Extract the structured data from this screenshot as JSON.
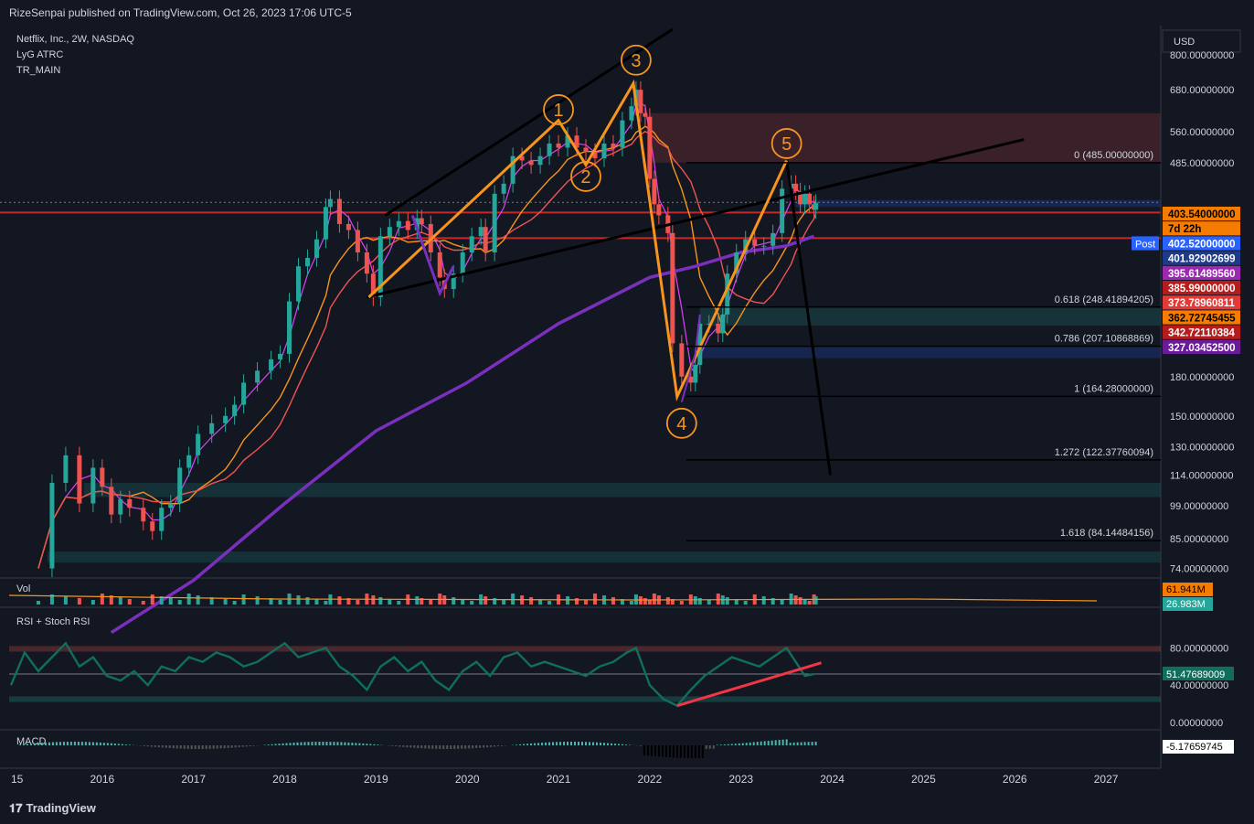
{
  "header": {
    "published": "RizeSenpai published on TradingView.com, Oct 26, 2023 17:06 UTC-5"
  },
  "legend": {
    "symbol": "Netflix, Inc., 2W, NASDAQ",
    "ind1": "LyG ATRC",
    "ind2": "TR_MAIN"
  },
  "currency": "USD",
  "footer": {
    "brand": "TradingView"
  },
  "colors": {
    "bg": "#131722",
    "up": "#26a69a",
    "down": "#ef5350",
    "orange": "#f7941d",
    "purple": "#7b2fbe",
    "pink": "#e040fb",
    "red": "#c62828",
    "black": "#000000",
    "text": "#d1d4dc"
  },
  "chart_data": {
    "type": "candlestick",
    "timeframe": "2W",
    "x_ticks": [
      "15",
      "2016",
      "2017",
      "2018",
      "2019",
      "2020",
      "2021",
      "2022",
      "2023",
      "2024",
      "2025",
      "2026",
      "2027"
    ],
    "y_scale": "log",
    "y_ticks": [
      "800.00000000",
      "680.00000000",
      "560.00000000",
      "485.00000000",
      "403.54000000",
      "180.00000000",
      "150.00000000",
      "130.00000000",
      "114.00000000",
      "99.00000000",
      "85.00000000",
      "74.00000000"
    ],
    "y_range": [
      72,
      900
    ],
    "close_series": [
      [
        2015.3,
        74
      ],
      [
        2015.45,
        110
      ],
      [
        2015.6,
        125
      ],
      [
        2015.75,
        100
      ],
      [
        2015.9,
        118
      ],
      [
        2016.0,
        108
      ],
      [
        2016.1,
        95
      ],
      [
        2016.2,
        102
      ],
      [
        2016.3,
        98
      ],
      [
        2016.45,
        92
      ],
      [
        2016.55,
        88
      ],
      [
        2016.65,
        98
      ],
      [
        2016.75,
        100
      ],
      [
        2016.85,
        118
      ],
      [
        2016.95,
        125
      ],
      [
        2017.05,
        138
      ],
      [
        2017.2,
        145
      ],
      [
        2017.35,
        150
      ],
      [
        2017.45,
        158
      ],
      [
        2017.55,
        175
      ],
      [
        2017.7,
        185
      ],
      [
        2017.85,
        195
      ],
      [
        2017.95,
        200
      ],
      [
        2018.05,
        255
      ],
      [
        2018.15,
        300
      ],
      [
        2018.25,
        312
      ],
      [
        2018.35,
        340
      ],
      [
        2018.45,
        395
      ],
      [
        2018.5,
        410
      ],
      [
        2018.6,
        365
      ],
      [
        2018.7,
        355
      ],
      [
        2018.8,
        320
      ],
      [
        2018.9,
        290
      ],
      [
        2018.97,
        260
      ],
      [
        2019.05,
        345
      ],
      [
        2019.15,
        360
      ],
      [
        2019.25,
        370
      ],
      [
        2019.35,
        355
      ],
      [
        2019.45,
        375
      ],
      [
        2019.5,
        365
      ],
      [
        2019.6,
        320
      ],
      [
        2019.7,
        285
      ],
      [
        2019.75,
        270
      ],
      [
        2019.85,
        290
      ],
      [
        2019.95,
        320
      ],
      [
        2020.05,
        345
      ],
      [
        2020.15,
        360
      ],
      [
        2020.2,
        320
      ],
      [
        2020.3,
        420
      ],
      [
        2020.4,
        440
      ],
      [
        2020.5,
        500
      ],
      [
        2020.6,
        490
      ],
      [
        2020.7,
        480
      ],
      [
        2020.8,
        500
      ],
      [
        2020.9,
        530
      ],
      [
        2021.0,
        520
      ],
      [
        2021.1,
        550
      ],
      [
        2021.2,
        520
      ],
      [
        2021.3,
        510
      ],
      [
        2021.4,
        495
      ],
      [
        2021.5,
        530
      ],
      [
        2021.6,
        520
      ],
      [
        2021.7,
        590
      ],
      [
        2021.8,
        630
      ],
      [
        2021.85,
        680
      ],
      [
        2021.9,
        610
      ],
      [
        2021.95,
        600
      ],
      [
        2022.0,
        450
      ],
      [
        2022.05,
        400
      ],
      [
        2022.1,
        380
      ],
      [
        2022.2,
        350
      ],
      [
        2022.25,
        210
      ],
      [
        2022.35,
        180
      ],
      [
        2022.45,
        175
      ],
      [
        2022.5,
        190
      ],
      [
        2022.55,
        230
      ],
      [
        2022.65,
        230
      ],
      [
        2022.75,
        220
      ],
      [
        2022.8,
        240
      ],
      [
        2022.85,
        290
      ],
      [
        2022.95,
        320
      ],
      [
        2023.05,
        340
      ],
      [
        2023.15,
        330
      ],
      [
        2023.25,
        330
      ],
      [
        2023.35,
        350
      ],
      [
        2023.45,
        430
      ],
      [
        2023.55,
        440
      ],
      [
        2023.6,
        425
      ],
      [
        2023.65,
        400
      ],
      [
        2023.7,
        420
      ],
      [
        2023.75,
        400
      ],
      [
        2023.8,
        390
      ],
      [
        2023.82,
        403
      ]
    ],
    "wave_labels": [
      {
        "text": "1",
        "x": 2021.0,
        "y": 620
      },
      {
        "text": "2",
        "x": 2021.3,
        "y": 455
      },
      {
        "text": "3",
        "x": 2021.85,
        "y": 780
      },
      {
        "text": "4",
        "x": 2022.35,
        "y": 145
      },
      {
        "text": "5",
        "x": 2023.5,
        "y": 530
      }
    ],
    "fib_levels": [
      {
        "label": "0 (485.00000000)",
        "value": 485
      },
      {
        "label": "0.618 (248.41894205)",
        "value": 248.42
      },
      {
        "label": "0.786 (207.10868869)",
        "value": 207.11
      },
      {
        "label": "1 (164.28000000)",
        "value": 164.28
      },
      {
        "label": "1.272 (122.37760094)",
        "value": 122.38
      },
      {
        "label": "1.618 (84.14484156)",
        "value": 84.14
      }
    ],
    "price_tags": [
      {
        "text": "403.54000000",
        "bg": "#f57c00",
        "fg": "#000000"
      },
      {
        "text": "7d 22h",
        "bg": "#f57c00",
        "fg": "#000000"
      },
      {
        "text": "402.52000000",
        "bg": "#2962ff",
        "fg": "#ffffff"
      },
      {
        "text": "401.92902699",
        "bg": "#1e3a8a",
        "fg": "#ffffff"
      },
      {
        "text": "395.61489560",
        "bg": "#9c27b0",
        "fg": "#ffffff"
      },
      {
        "text": "385.99000000",
        "bg": "#b71c1c",
        "fg": "#ffffff"
      },
      {
        "text": "373.78960811",
        "bg": "#e53935",
        "fg": "#ffffff"
      },
      {
        "text": "362.72745455",
        "bg": "#f57c00",
        "fg": "#000000"
      },
      {
        "text": "342.72110384",
        "bg": "#b71c1c",
        "fg": "#ffffff"
      },
      {
        "text": "327.03452500",
        "bg": "#6a1b9a",
        "fg": "#ffffff"
      }
    ],
    "post_label": "Post",
    "volume": {
      "title": "Vol",
      "tags": [
        "61.941M",
        "26.983M"
      ]
    },
    "rsi": {
      "title": "RSI + Stoch RSI",
      "y_ticks": [
        "80.00000000",
        "40.00000000",
        "0.00000000"
      ],
      "current": "51.47689009",
      "values": [
        [
          2015.0,
          40
        ],
        [
          2015.15,
          75
        ],
        [
          2015.3,
          55
        ],
        [
          2015.45,
          70
        ],
        [
          2015.6,
          85
        ],
        [
          2015.75,
          60
        ],
        [
          2015.9,
          70
        ],
        [
          2016.05,
          50
        ],
        [
          2016.2,
          45
        ],
        [
          2016.35,
          55
        ],
        [
          2016.5,
          40
        ],
        [
          2016.65,
          60
        ],
        [
          2016.8,
          55
        ],
        [
          2016.95,
          70
        ],
        [
          2017.1,
          65
        ],
        [
          2017.25,
          75
        ],
        [
          2017.4,
          70
        ],
        [
          2017.55,
          60
        ],
        [
          2017.7,
          65
        ],
        [
          2017.85,
          75
        ],
        [
          2018.0,
          85
        ],
        [
          2018.15,
          70
        ],
        [
          2018.3,
          75
        ],
        [
          2018.45,
          80
        ],
        [
          2018.6,
          60
        ],
        [
          2018.75,
          50
        ],
        [
          2018.9,
          35
        ],
        [
          2019.05,
          60
        ],
        [
          2019.2,
          70
        ],
        [
          2019.35,
          55
        ],
        [
          2019.5,
          65
        ],
        [
          2019.65,
          45
        ],
        [
          2019.8,
          35
        ],
        [
          2019.95,
          55
        ],
        [
          2020.1,
          65
        ],
        [
          2020.25,
          50
        ],
        [
          2020.4,
          70
        ],
        [
          2020.55,
          75
        ],
        [
          2020.7,
          60
        ],
        [
          2020.85,
          65
        ],
        [
          2021.0,
          60
        ],
        [
          2021.15,
          55
        ],
        [
          2021.3,
          50
        ],
        [
          2021.45,
          60
        ],
        [
          2021.6,
          65
        ],
        [
          2021.75,
          75
        ],
        [
          2021.85,
          80
        ],
        [
          2022.0,
          40
        ],
        [
          2022.15,
          25
        ],
        [
          2022.3,
          18
        ],
        [
          2022.45,
          35
        ],
        [
          2022.6,
          50
        ],
        [
          2022.75,
          60
        ],
        [
          2022.9,
          70
        ],
        [
          2023.05,
          65
        ],
        [
          2023.2,
          60
        ],
        [
          2023.35,
          70
        ],
        [
          2023.5,
          80
        ],
        [
          2023.6,
          65
        ],
        [
          2023.7,
          50
        ],
        [
          2023.8,
          52
        ]
      ]
    },
    "macd": {
      "title": "MACD",
      "current": "-5.17659745"
    }
  }
}
